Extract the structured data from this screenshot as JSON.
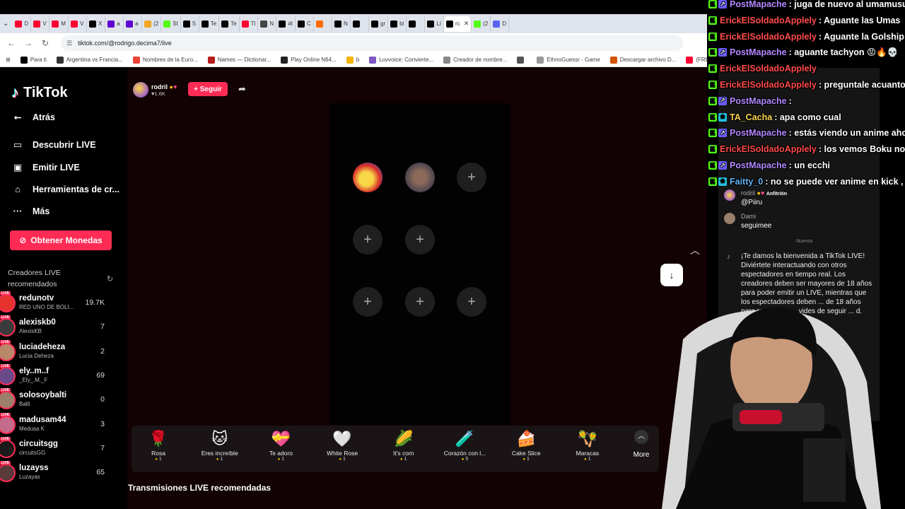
{
  "browser": {
    "tabs": [
      {
        "label": "D",
        "color": "#ff0033"
      },
      {
        "label": "V",
        "color": "#ff0033"
      },
      {
        "label": "M",
        "color": "#ff0033"
      },
      {
        "label": "V",
        "color": "#ff0033"
      },
      {
        "label": "X",
        "color": "#000000"
      },
      {
        "label": "a",
        "color": "#6001d2"
      },
      {
        "label": "a",
        "color": "#6001d2"
      },
      {
        "label": "(2",
        "color": "#f5a623"
      },
      {
        "label": "St",
        "color": "#53fc18"
      },
      {
        "label": "S",
        "color": "#000000"
      },
      {
        "label": "Te",
        "color": "#000000"
      },
      {
        "label": "Te",
        "color": "#000000"
      },
      {
        "label": "Tl",
        "color": "#ff0033"
      },
      {
        "label": "N",
        "color": "#444444"
      },
      {
        "label": "#t",
        "color": "#000000"
      },
      {
        "label": "C",
        "color": "#000000"
      },
      {
        "label": "",
        "color": "#ff6a00"
      },
      {
        "label": "N",
        "color": "#000000"
      },
      {
        "label": "",
        "color": "#000000"
      },
      {
        "label": "gr",
        "color": "#000000"
      },
      {
        "label": "bi",
        "color": "#000000"
      },
      {
        "label": "",
        "color": "#000000"
      },
      {
        "label": "Lí",
        "color": "#000000"
      },
      {
        "label": "rc",
        "color": "#000000",
        "active": true
      },
      {
        "label": "(2",
        "color": "#53fc18"
      },
      {
        "label": "D",
        "color": "#5865f2"
      }
    ],
    "close_glyph": "✕",
    "url": "tiktok.com/@rodrigo.decima7/live",
    "bookmarks": [
      {
        "label": "Para ti",
        "color": "#000000"
      },
      {
        "label": "Argentina vs Francia...",
        "color": "#333333"
      },
      {
        "label": "Nombres de la Euro...",
        "color": "#ea4335"
      },
      {
        "label": "Names — Dictionar...",
        "color": "#b71c1c"
      },
      {
        "label": "Play Online N64...",
        "color": "#222222"
      },
      {
        "label": "b",
        "color": "#f4b400"
      },
      {
        "label": "Luvvoice: Convierte...",
        "color": "#7e57c2"
      },
      {
        "label": "Creador de nombre...",
        "color": "#888888"
      },
      {
        "label": "",
        "color": "#555555"
      },
      {
        "label": "EthnoGuessr - Game",
        "color": "#999999"
      },
      {
        "label": "Descargar archivo D...",
        "color": "#d35400"
      },
      {
        "label": "(FREE FOR PROFIT) ...",
        "color": "#ff0033"
      }
    ]
  },
  "tiktok": {
    "brand": "TikTok",
    "nav": {
      "back": "Atrás",
      "discover": "Descubrir LIVE",
      "go_live": "Emitir LIVE",
      "tools": "Herramientas de cr...",
      "more": "Más"
    },
    "coins_button": "Obtener Monedas",
    "recommended_title": "Creadores LIVE recomendados",
    "creators": [
      {
        "name": "redunotv",
        "sub": "RED UNO DE BOLI...",
        "count": "19.7K",
        "color": "#e5322d"
      },
      {
        "name": "alexiskb0",
        "sub": "AlexisKB",
        "count": "7",
        "color": "#3a3a3a"
      },
      {
        "name": "luciadeheza",
        "sub": "Lucia Deheza",
        "count": "2",
        "color": "#b9876a"
      },
      {
        "name": "ely..m..f",
        "sub": "_Ely_.M._F",
        "count": "69",
        "color": "#6b4a8c"
      },
      {
        "name": "solosoybalti",
        "sub": "Balti",
        "count": "0",
        "color": "#9a7f6a"
      },
      {
        "name": "madusam44",
        "sub": "Medusa K",
        "count": "3",
        "color": "#c46a8a"
      },
      {
        "name": "circuitsgg",
        "sub": "circuitsGG",
        "count": "7",
        "color": "#1a1a1a"
      },
      {
        "name": "luzayss",
        "sub": "Luzayas",
        "count": "65",
        "color": "#5a3a3a"
      }
    ],
    "host": {
      "name": "rodril",
      "likes": "1.6K"
    },
    "follow_button": "+ Seguir",
    "gifts": [
      {
        "name": "Rosa",
        "price": "1",
        "icon": "🌹"
      },
      {
        "name": "Eres increíble",
        "price": "1",
        "icon": "🐱"
      },
      {
        "name": "Te adoro",
        "price": "1",
        "icon": "💝"
      },
      {
        "name": "White Rose",
        "price": "1",
        "icon": "🤍"
      },
      {
        "name": "It's corn",
        "price": "1",
        "icon": "🌽"
      },
      {
        "name": "Corazón con l...",
        "price": "5",
        "icon": "🧪"
      },
      {
        "name": "Cake Slice",
        "price": "1",
        "icon": "🍰"
      },
      {
        "name": "Maracas",
        "price": "1",
        "icon": "🪇"
      }
    ],
    "more_label": "More",
    "recommended_streams": "Transmisiones LIVE recomendadas"
  },
  "chat_panel": {
    "messages": [
      {
        "name": "rodril",
        "role": "Anfitrión",
        "text": "@Piiru"
      },
      {
        "name": "Dami",
        "text": "seguimee"
      }
    ],
    "divider": "Nuevos",
    "welcome": "¡Te damos la bienvenida a TikTok LIVE! Diviértete interactuando con otros espectadores en tiempo real. Los creadores deben ser mayores de 18 años para poder emitir un LIVE, mientras que los espectadores deben ... de 18 años para recargar y ... vides de seguir ... d."
  },
  "overlay_chat": [
    {
      "user": "PostMapache",
      "color": "#b388ff",
      "msg": ": juga de nuevo al umamusu",
      "badges": [
        "k",
        "p"
      ]
    },
    {
      "user": "ErickElSoldadoApplely",
      "color": "#ff4b4b",
      "msg": ": Aguante las Umas",
      "badges": [
        "k"
      ]
    },
    {
      "user": "ErickElSoldadoApplely",
      "color": "#ff4b4b",
      "msg": ": Aguante la Golship",
      "badges": [
        "k"
      ]
    },
    {
      "user": "PostMapache",
      "color": "#b388ff",
      "msg": ": aguante tachyon 😡🔥💀",
      "badges": [
        "k",
        "p"
      ]
    },
    {
      "user": "ErickElSoldadoApplely",
      "color": "#ff4b4b",
      "msg": "",
      "badges": [
        "k"
      ]
    },
    {
      "user": "ErickElSoldadoApplely",
      "color": "#ff4b4b",
      "msg": ": preguntale acuanto",
      "badges": [
        "k"
      ]
    },
    {
      "user": "PostMapache",
      "color": "#b388ff",
      "msg": ":",
      "badges": [
        "k",
        "p"
      ]
    },
    {
      "user": "TA_Cacha",
      "color": "#ffd54f",
      "msg": ": apa como cual",
      "badges": [
        "k",
        "m"
      ]
    },
    {
      "user": "PostMapache",
      "color": "#b388ff",
      "msg": ": estás viendo un anime aho",
      "badges": [
        "k",
        "p"
      ]
    },
    {
      "user": "ErickElSoldadoApplely",
      "color": "#ff4b4b",
      "msg": ": los vemos Boku no p",
      "badges": [
        "k"
      ]
    },
    {
      "user": "PostMapache",
      "color": "#b388ff",
      "msg": ": un ecchi",
      "badges": [
        "k",
        "p"
      ]
    },
    {
      "user": "Faitty_0",
      "color": "#64b5f6",
      "msg": ": no se puede ver anime en kick ,",
      "badges": [
        "k",
        "m"
      ]
    }
  ],
  "colors": {
    "accent": "#fe2c55",
    "page_bg": "#120203"
  }
}
